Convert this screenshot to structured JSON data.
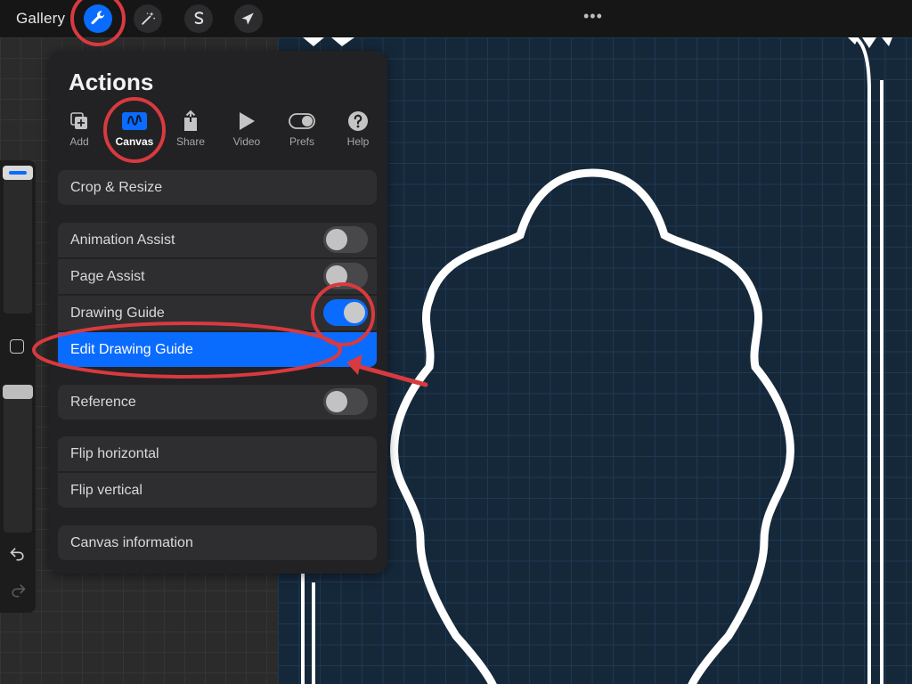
{
  "topbar": {
    "gallery_label": "Gallery",
    "more_label": "•••",
    "buttons": [
      {
        "name": "actions",
        "icon": "wrench-icon",
        "active": true
      },
      {
        "name": "adjustments",
        "icon": "magic-wand-icon",
        "active": false
      },
      {
        "name": "selection",
        "icon": "selection-s-icon",
        "active": false
      },
      {
        "name": "transform",
        "icon": "arrow-cursor-icon",
        "active": false
      }
    ]
  },
  "actions": {
    "title": "Actions",
    "tabs": [
      {
        "label": "Add",
        "icon": "add-layers-icon"
      },
      {
        "label": "Canvas",
        "icon": "canvas-icon",
        "active": true
      },
      {
        "label": "Share",
        "icon": "share-icon"
      },
      {
        "label": "Video",
        "icon": "play-icon"
      },
      {
        "label": "Prefs",
        "icon": "toggle-icon"
      },
      {
        "label": "Help",
        "icon": "help-icon"
      }
    ],
    "items": {
      "crop_resize": "Crop & Resize",
      "animation_assist": "Animation Assist",
      "page_assist": "Page Assist",
      "drawing_guide": "Drawing Guide",
      "edit_drawing_guide": "Edit Drawing Guide",
      "reference": "Reference",
      "flip_horizontal": "Flip horizontal",
      "flip_vertical": "Flip vertical",
      "canvas_information": "Canvas information"
    },
    "toggles": {
      "animation_assist": false,
      "page_assist": false,
      "drawing_guide": true,
      "reference": false
    }
  },
  "colors": {
    "accent": "#0a6bff",
    "annotation": "#d83a3f",
    "canvas_bg": "#15283a",
    "panel_bg": "#222224"
  }
}
